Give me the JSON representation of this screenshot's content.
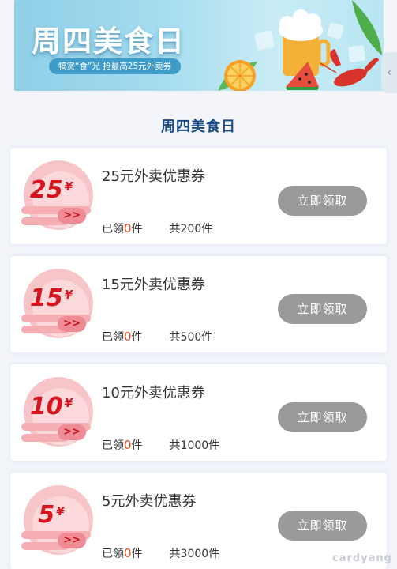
{
  "banner": {
    "title": "周四美食日",
    "subtitle": "犒赏“食”光 抢最高25元外卖券"
  },
  "section_title": "周四美食日",
  "coupons": [
    {
      "amount": "25",
      "currency": "¥",
      "name": "25元外卖优惠券",
      "claimed_label": "已领",
      "claimed": "0",
      "claimed_unit": "件",
      "total": "共200件",
      "button": "立即领取"
    },
    {
      "amount": "15",
      "currency": "¥",
      "name": "15元外卖优惠券",
      "claimed_label": "已领",
      "claimed": "0",
      "claimed_unit": "件",
      "total": "共500件",
      "button": "立即领取"
    },
    {
      "amount": "10",
      "currency": "¥",
      "name": "10元外卖优惠券",
      "claimed_label": "已领",
      "claimed": "0",
      "claimed_unit": "件",
      "total": "共1000件",
      "button": "立即领取"
    },
    {
      "amount": "5",
      "currency": "¥",
      "name": "5元外卖优惠券",
      "claimed_label": "已领",
      "claimed": "0",
      "claimed_unit": "件",
      "total": "共3000件",
      "button": "立即领取"
    }
  ],
  "badge_arrow": ">>",
  "watermark": "cardyang",
  "colors": {
    "title_blue": "#1b4a86",
    "badge_red": "#d7141e",
    "claimed_orange": "#e34a1c",
    "button_gray": "#9a9a9a"
  }
}
